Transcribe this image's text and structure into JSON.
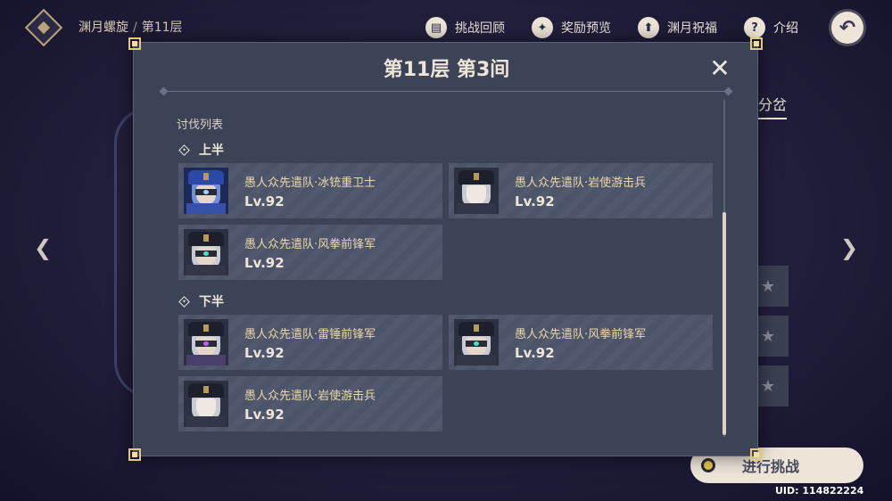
{
  "header": {
    "breadcrumb_parent": "渊月螺旋",
    "breadcrumb_separator": "/",
    "breadcrumb_current": "第11层",
    "buttons": [
      {
        "label": "挑战回顾",
        "icon": "book-icon"
      },
      {
        "label": "奖励预览",
        "icon": "star-badge-icon"
      },
      {
        "label": "渊月祝福",
        "icon": "upgrade-arrow-icon"
      },
      {
        "label": "介绍",
        "icon": "help-icon"
      }
    ],
    "back_icon": "back-arrow-icon"
  },
  "background": {
    "tab_label": "分岔",
    "start_button_label": "进行挑战",
    "uid_text": "UID: 114822224"
  },
  "modal": {
    "title": "第11层 第3间",
    "list_title": "讨伐列表",
    "sections": [
      {
        "label": "上半",
        "enemies": [
          {
            "name": "愚人众先遣队·冰铳重卫士",
            "level": "Lv.92",
            "portrait": "cryo-gunner-portrait"
          },
          {
            "name": "愚人众先遣队·岩使游击兵",
            "level": "Lv.92",
            "portrait": "geochanter-portrait"
          },
          {
            "name": "愚人众先遣队·风拳前锋军",
            "level": "Lv.92",
            "portrait": "anemoboxer-portrait"
          }
        ]
      },
      {
        "label": "下半",
        "enemies": [
          {
            "name": "愚人众先遣队·雷锤前锋军",
            "level": "Lv.92",
            "portrait": "electrohammer-portrait"
          },
          {
            "name": "愚人众先遣队·风拳前锋军",
            "level": "Lv.92",
            "portrait": "anemoboxer-portrait"
          },
          {
            "name": "愚人众先遣队·岩使游击兵",
            "level": "Lv.92",
            "portrait": "geochanter-portrait"
          }
        ]
      }
    ],
    "scroll_position": 0.55
  },
  "colors": {
    "modal_bg": "#3c4357",
    "card_bg": "#4c5469",
    "accent_gold": "#e7c878",
    "text_cream": "#ece5d8",
    "name_text": "#ebd8a8"
  }
}
